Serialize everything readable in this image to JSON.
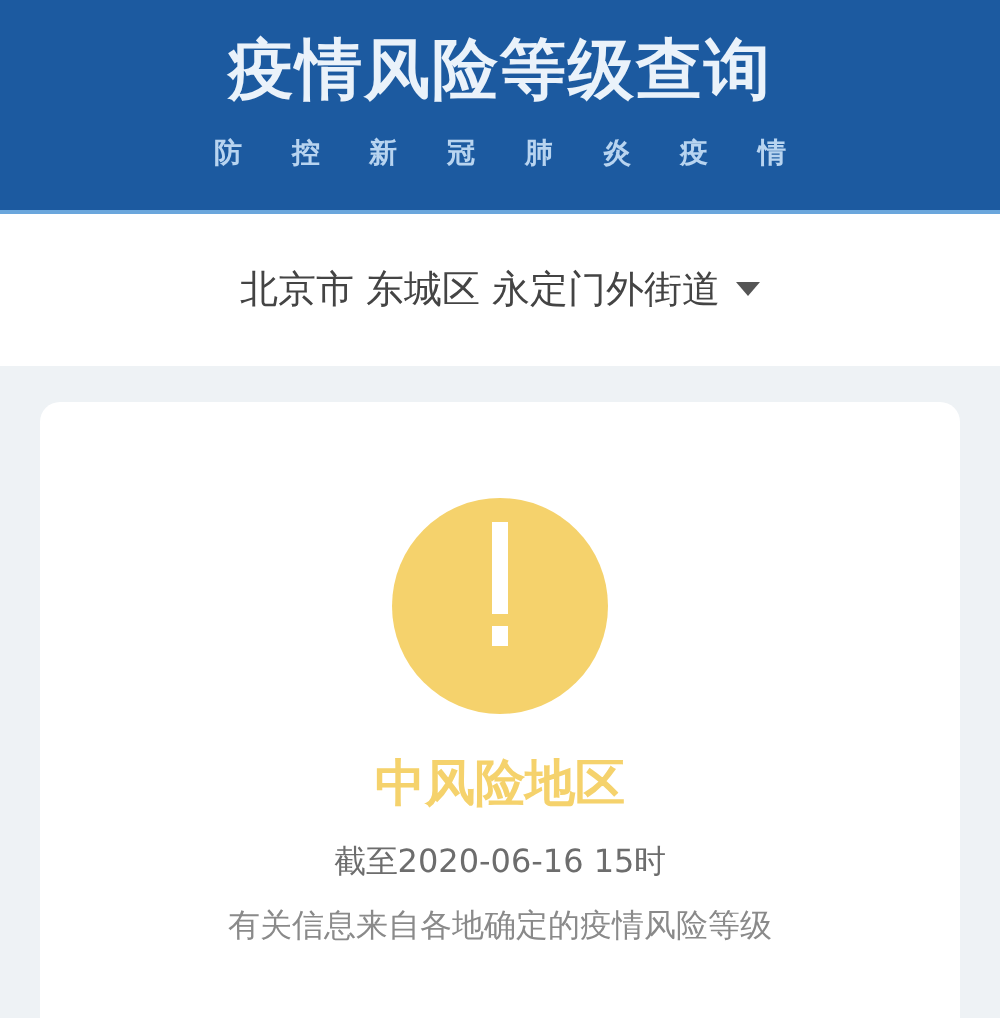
{
  "header": {
    "title": "疫情风险等级查询",
    "subtitle": "防 控 新 冠 肺 炎 疫 情"
  },
  "location": {
    "text": "北京市 东城区 永定门外街道"
  },
  "result": {
    "kind": "medium",
    "label": "中风险地区",
    "time": "截至2020-06-16 15时",
    "note": "有关信息来自各地确定的疫情风险等级"
  }
}
